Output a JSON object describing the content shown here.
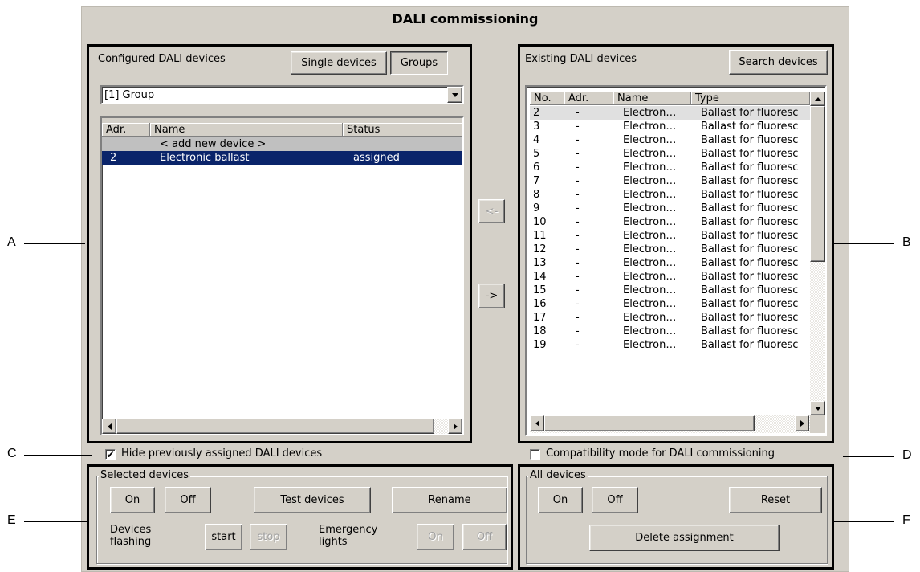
{
  "window": {
    "title": "DALI commissioning"
  },
  "callouts": {
    "a": "A",
    "b": "B",
    "c": "C",
    "d": "D",
    "e": "E",
    "f": "F"
  },
  "configured": {
    "heading": "Configured DALI devices",
    "single_devices_label": "Single devices",
    "groups_label": "Groups",
    "group_select_value": "[1] Group",
    "columns": [
      "Adr.",
      "Name",
      "Status"
    ],
    "rows": [
      {
        "adr": "",
        "name": "< add new device >",
        "status": ""
      },
      {
        "adr": "2",
        "name": "Electronic ballast",
        "status": "assigned"
      }
    ]
  },
  "transfer": {
    "left_label": "<-",
    "right_label": "->"
  },
  "existing": {
    "heading": "Existing DALI devices",
    "search_label": "Search devices",
    "columns": [
      "No.",
      "Adr.",
      "Name",
      "Type"
    ],
    "rows": [
      {
        "no": "2",
        "adr": "-",
        "name": "Electron…",
        "type": "Ballast for fluoresc"
      },
      {
        "no": "3",
        "adr": "-",
        "name": "Electron…",
        "type": "Ballast for fluoresc"
      },
      {
        "no": "4",
        "adr": "-",
        "name": "Electron…",
        "type": "Ballast for fluoresc"
      },
      {
        "no": "5",
        "adr": "-",
        "name": "Electron…",
        "type": "Ballast for fluoresc"
      },
      {
        "no": "6",
        "adr": "-",
        "name": "Electron…",
        "type": "Ballast for fluoresc"
      },
      {
        "no": "7",
        "adr": "-",
        "name": "Electron…",
        "type": "Ballast for fluoresc"
      },
      {
        "no": "8",
        "adr": "-",
        "name": "Electron…",
        "type": "Ballast for fluoresc"
      },
      {
        "no": "9",
        "adr": "-",
        "name": "Electron…",
        "type": "Ballast for fluoresc"
      },
      {
        "no": "10",
        "adr": "-",
        "name": "Electron…",
        "type": "Ballast for fluoresc"
      },
      {
        "no": "11",
        "adr": "-",
        "name": "Electron…",
        "type": "Ballast for fluoresc"
      },
      {
        "no": "12",
        "adr": "-",
        "name": "Electron…",
        "type": "Ballast for fluoresc"
      },
      {
        "no": "13",
        "adr": "-",
        "name": "Electron…",
        "type": "Ballast for fluoresc"
      },
      {
        "no": "14",
        "adr": "-",
        "name": "Electron…",
        "type": "Ballast for fluoresc"
      },
      {
        "no": "15",
        "adr": "-",
        "name": "Electron…",
        "type": "Ballast for fluoresc"
      },
      {
        "no": "16",
        "adr": "-",
        "name": "Electron…",
        "type": "Ballast for fluoresc"
      },
      {
        "no": "17",
        "adr": "-",
        "name": "Electron…",
        "type": "Ballast for fluoresc"
      },
      {
        "no": "18",
        "adr": "-",
        "name": "Electron…",
        "type": "Ballast for fluoresc"
      },
      {
        "no": "19",
        "adr": "-",
        "name": "Electron…",
        "type": "Ballast for fluoresc"
      }
    ]
  },
  "options": {
    "hide_assigned_label": "Hide previously assigned DALI devices",
    "hide_assigned_checked": true,
    "compat_label": "Compatibility mode for DALI commissioning",
    "compat_checked": false
  },
  "selected_devices": {
    "title": "Selected devices",
    "on_label": "On",
    "off_label": "Off",
    "test_label": "Test devices",
    "rename_label": "Rename",
    "flashing_label_1": "Devices",
    "flashing_label_2": "flashing",
    "start_label": "start",
    "stop_label": "stop",
    "emergency_label_1": "Emergency",
    "emergency_label_2": "lights",
    "em_on_label": "On",
    "em_off_label": "Off"
  },
  "all_devices": {
    "title": "All devices",
    "on_label": "On",
    "off_label": "Off",
    "reset_label": "Reset",
    "delete_label": "Delete assignment"
  },
  "colors": {
    "window_bg": "#d4d0c8",
    "selection": "#0a246a",
    "frame": "#000000"
  }
}
